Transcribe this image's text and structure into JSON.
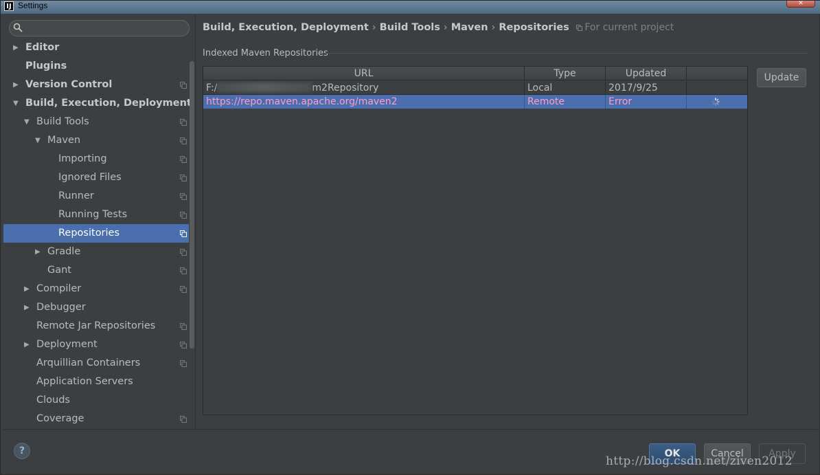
{
  "window": {
    "title": "Settings",
    "logo": "IJ"
  },
  "search": {
    "placeholder": "",
    "value": ""
  },
  "tree": [
    {
      "label": "Editor",
      "level": 0,
      "arrow": "▶",
      "bold": true,
      "project": false,
      "selected": false
    },
    {
      "label": "Plugins",
      "level": 0,
      "arrow": "",
      "bold": true,
      "project": false,
      "selected": false
    },
    {
      "label": "Version Control",
      "level": 0,
      "arrow": "▶",
      "bold": true,
      "project": true,
      "selected": false
    },
    {
      "label": "Build, Execution, Deployment",
      "level": 0,
      "arrow": "▼",
      "bold": true,
      "project": false,
      "selected": false
    },
    {
      "label": "Build Tools",
      "level": 1,
      "arrow": "▼",
      "bold": false,
      "project": true,
      "selected": false
    },
    {
      "label": "Maven",
      "level": 2,
      "arrow": "▼",
      "bold": false,
      "project": true,
      "selected": false
    },
    {
      "label": "Importing",
      "level": 3,
      "arrow": "",
      "bold": false,
      "project": true,
      "selected": false
    },
    {
      "label": "Ignored Files",
      "level": 3,
      "arrow": "",
      "bold": false,
      "project": true,
      "selected": false
    },
    {
      "label": "Runner",
      "level": 3,
      "arrow": "",
      "bold": false,
      "project": true,
      "selected": false
    },
    {
      "label": "Running Tests",
      "level": 3,
      "arrow": "",
      "bold": false,
      "project": true,
      "selected": false
    },
    {
      "label": "Repositories",
      "level": 3,
      "arrow": "",
      "bold": false,
      "project": true,
      "selected": true
    },
    {
      "label": "Gradle",
      "level": 2,
      "arrow": "▶",
      "bold": false,
      "project": true,
      "selected": false
    },
    {
      "label": "Gant",
      "level": 2,
      "arrow": "",
      "bold": false,
      "project": true,
      "selected": false
    },
    {
      "label": "Compiler",
      "level": 1,
      "arrow": "▶",
      "bold": false,
      "project": true,
      "selected": false
    },
    {
      "label": "Debugger",
      "level": 1,
      "arrow": "▶",
      "bold": false,
      "project": false,
      "selected": false
    },
    {
      "label": "Remote Jar Repositories",
      "level": 1,
      "arrow": "",
      "bold": false,
      "project": true,
      "selected": false
    },
    {
      "label": "Deployment",
      "level": 1,
      "arrow": "▶",
      "bold": false,
      "project": true,
      "selected": false
    },
    {
      "label": "Arquillian Containers",
      "level": 1,
      "arrow": "",
      "bold": false,
      "project": true,
      "selected": false
    },
    {
      "label": "Application Servers",
      "level": 1,
      "arrow": "",
      "bold": false,
      "project": false,
      "selected": false
    },
    {
      "label": "Clouds",
      "level": 1,
      "arrow": "",
      "bold": false,
      "project": false,
      "selected": false
    },
    {
      "label": "Coverage",
      "level": 1,
      "arrow": "",
      "bold": false,
      "project": true,
      "selected": false
    }
  ],
  "breadcrumb": {
    "items": [
      "Build, Execution, Deployment",
      "Build Tools",
      "Maven",
      "Repositories"
    ],
    "separator": "›",
    "project_note": "For current project"
  },
  "repositories": {
    "group_title": "Indexed Maven Repositories",
    "columns": [
      "URL",
      "Type",
      "Updated",
      ""
    ],
    "rows": [
      {
        "url_prefix": "F:/",
        "url_suffix": "m2Repository",
        "type": "Local",
        "updated": "2017/9/25",
        "selected": false
      },
      {
        "url": "https://repo.maven.apache.org/maven2",
        "type": "Remote",
        "updated": "Error",
        "selected": true
      }
    ],
    "update_label": "Update"
  },
  "footer": {
    "help_label": "?",
    "ok_label": "OK",
    "cancel_label": "Cancel",
    "apply_label": "Apply"
  },
  "watermark": "http://blog.csdn.net/ziven2012",
  "colors": {
    "selection": "#4b6eaf",
    "background": "#3c3f41",
    "selected_text": "#ff9ec8"
  }
}
